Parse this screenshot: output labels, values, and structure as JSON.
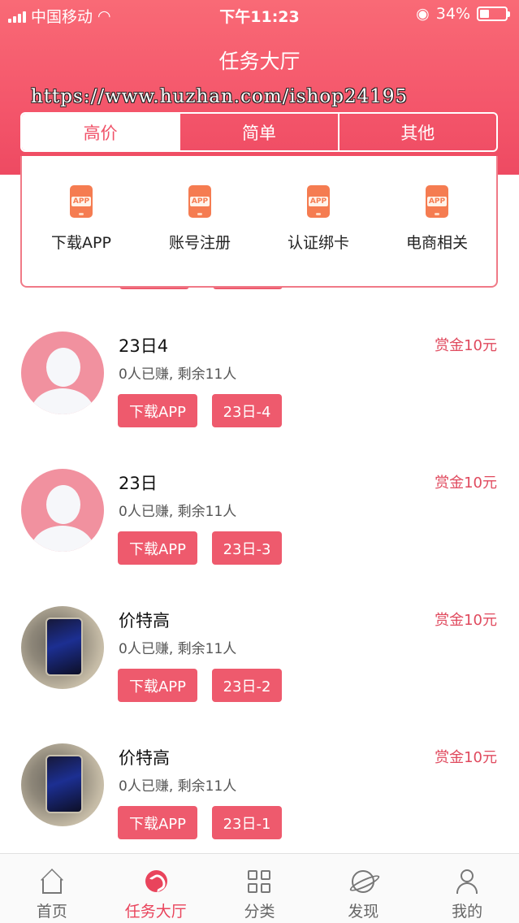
{
  "status_bar": {
    "carrier": "中国移动",
    "time": "下午11:23",
    "battery": "34%"
  },
  "header": {
    "title": "任务大厅",
    "watermark": "https://www.huzhan.com/ishop24195"
  },
  "tabs": [
    {
      "label": "高价",
      "active": true
    },
    {
      "label": "简单",
      "active": false
    },
    {
      "label": "其他",
      "active": false
    }
  ],
  "categories": [
    {
      "label": "下载APP",
      "icon": "app-icon",
      "badge": "APP"
    },
    {
      "label": "账号注册",
      "icon": "app-icon",
      "badge": "APP"
    },
    {
      "label": "认证绑卡",
      "icon": "app-icon",
      "badge": "APP"
    },
    {
      "label": "电商相关",
      "icon": "app-icon",
      "badge": "APP"
    }
  ],
  "tasks": [
    {
      "title": "23日4",
      "sub": "0人已赚, 剩余11人",
      "reward": "赏金10元",
      "tags": [
        "下载APP",
        "23日-4"
      ],
      "avatar": "default-avatar"
    },
    {
      "title": "23日",
      "sub": "0人已赚, 剩余11人",
      "reward": "赏金10元",
      "tags": [
        "下载APP",
        "23日-3"
      ],
      "avatar": "default-avatar"
    },
    {
      "title": "价特高",
      "sub": "0人已赚, 剩余11人",
      "reward": "赏金10元",
      "tags": [
        "下载APP",
        "23日-2"
      ],
      "avatar": "phone-photo"
    },
    {
      "title": "价特高",
      "sub": "0人已赚, 剩余11人",
      "reward": "赏金10元",
      "tags": [
        "下载APP",
        "23日-1"
      ],
      "avatar": "phone-photo"
    }
  ],
  "bottom_nav": [
    {
      "label": "首页",
      "icon": "home-icon",
      "active": false
    },
    {
      "label": "任务大厅",
      "icon": "task-hall-icon",
      "active": true
    },
    {
      "label": "分类",
      "icon": "grid-icon",
      "active": false
    },
    {
      "label": "发现",
      "icon": "planet-icon",
      "active": false
    },
    {
      "label": "我的",
      "icon": "user-icon",
      "active": false
    }
  ],
  "colors": {
    "brand": "#f05268",
    "tag": "#ee5a6d",
    "reward": "#e04a5e"
  }
}
